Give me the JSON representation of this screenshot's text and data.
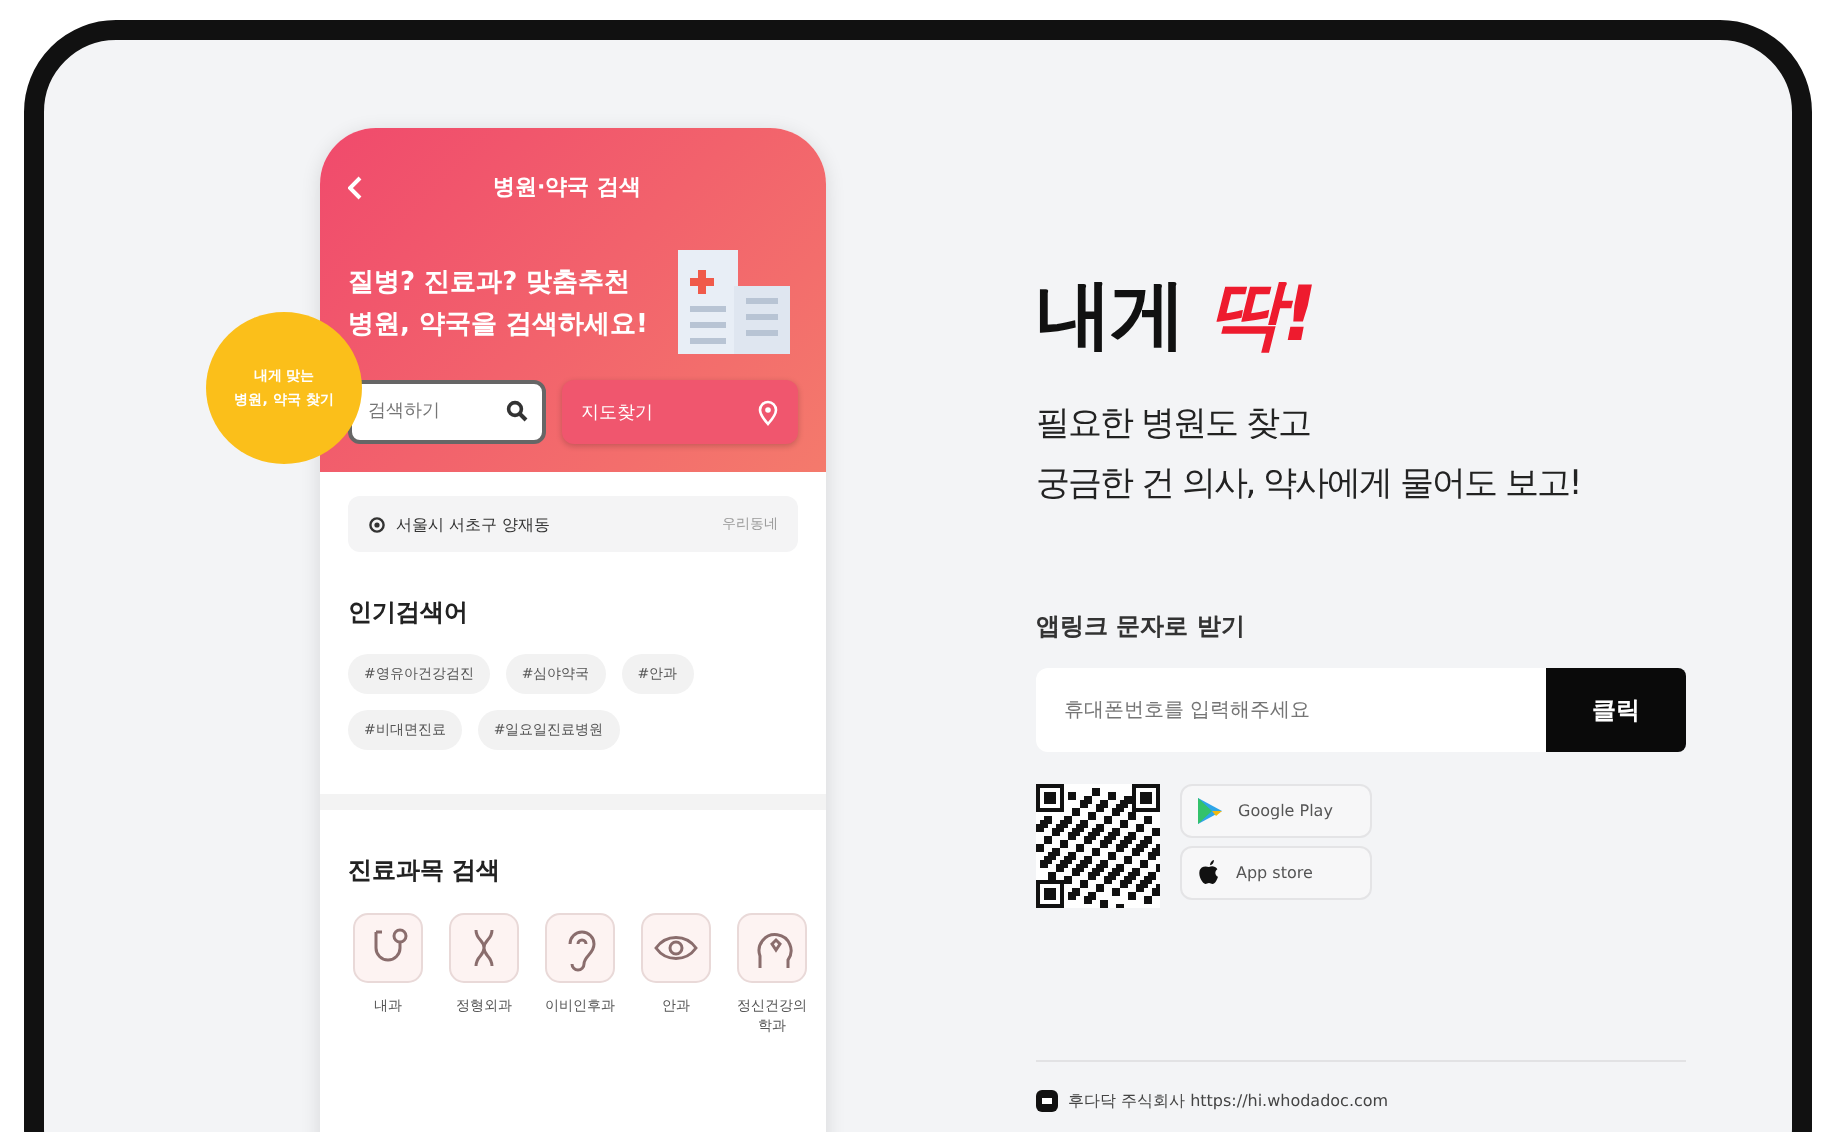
{
  "phone": {
    "title": "병원·약국 검색",
    "headline": [
      "질병? 진료과? 맞춤추천",
      "병원, 약국을 검색하세요!"
    ],
    "bubble": [
      "내게 맞는",
      "병원, 약국 찾기"
    ],
    "search": {
      "placeholder": "검색하기"
    },
    "map_button": "지도찾기",
    "location": "서울시 서초구 양재동",
    "location_link": "우리동네",
    "popular": {
      "title": "인기검색어",
      "tags": [
        "#영유아건강검진",
        "#심야약국",
        "#안과",
        "#비대면진료",
        "#일요일진료병원"
      ]
    },
    "departments": {
      "title": "진료과목 검색",
      "items": [
        {
          "label": "내과",
          "kind": "stethoscope"
        },
        {
          "label": "정형외과",
          "kind": "joint"
        },
        {
          "label": "이비인후과",
          "kind": "ear"
        },
        {
          "label": "안과",
          "kind": "eye"
        },
        {
          "label": "정신건강의학과",
          "kind": "head"
        }
      ]
    }
  },
  "hero": {
    "title": "내게",
    "accent": "딱!",
    "lines": [
      "필요한 병원도 찾고",
      "궁금한 건 의사, 약사에게 물어도 보고!"
    ]
  },
  "sms": {
    "label": "앱링크 문자로 받기",
    "placeholder": "휴대폰번호를 입력해주세요",
    "button": "클릭"
  },
  "stores": [
    {
      "label": "Google Play",
      "kind": "google"
    },
    {
      "label": "App store",
      "kind": "apple"
    }
  ],
  "footer": "후다닥 주식회사 https://hi.whodadoc.com"
}
